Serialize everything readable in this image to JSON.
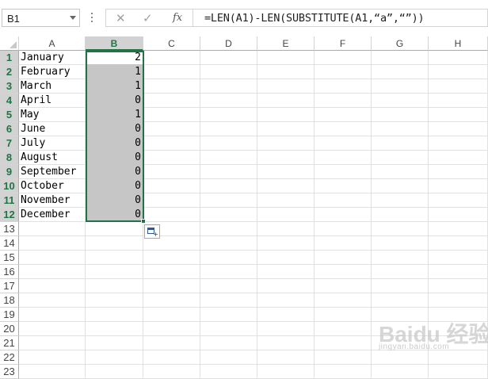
{
  "name_box": {
    "value": "B1"
  },
  "formula_bar": {
    "cancel_icon": "✕",
    "enter_icon": "✓",
    "fx_label": "fx",
    "formula": "=LEN(A1)-LEN(SUBSTITUTE(A1,“a”,“”))"
  },
  "columns": [
    "A",
    "B",
    "C",
    "D",
    "E",
    "F",
    "G",
    "H"
  ],
  "active_column": "B",
  "rows": [
    "1",
    "2",
    "3",
    "4",
    "5",
    "6",
    "7",
    "8",
    "9",
    "10",
    "11",
    "12",
    "13",
    "14",
    "15",
    "16",
    "17",
    "18",
    "19",
    "20",
    "21",
    "22",
    "23"
  ],
  "sheet": {
    "col_a": [
      "January",
      "February",
      "March",
      "April",
      "May",
      "June",
      "July",
      "August",
      "September",
      "October",
      "November",
      "December"
    ],
    "col_b": [
      "2",
      "1",
      "1",
      "0",
      "1",
      "0",
      "0",
      "0",
      "0",
      "0",
      "0",
      "0"
    ]
  },
  "watermark": {
    "text": "Baidu 经验",
    "sub": "jingyan.baidu.com"
  }
}
